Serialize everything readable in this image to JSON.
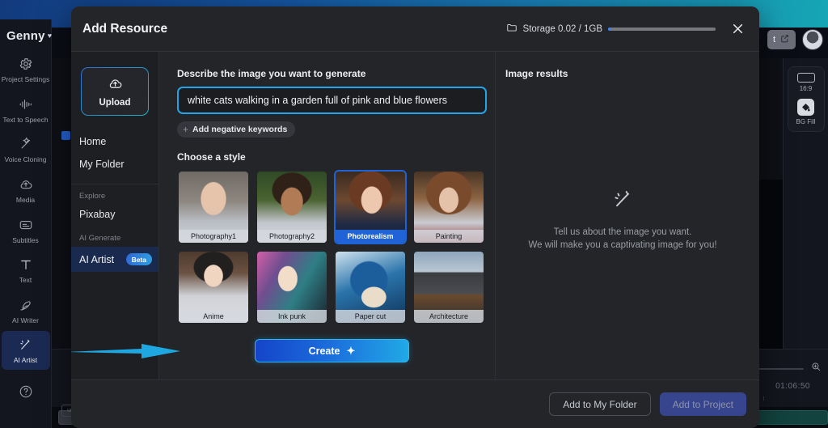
{
  "background_app": {
    "logo": "Genny",
    "nav_items": [
      {
        "label": "Project Settings",
        "icon": "gear-icon",
        "active": false
      },
      {
        "label": "Text to Speech",
        "icon": "waveform-icon",
        "active": false
      },
      {
        "label": "Voice Cloning",
        "icon": "voice-clone-icon",
        "active": false
      },
      {
        "label": "Media",
        "icon": "cloud-upload-icon",
        "active": false
      },
      {
        "label": "Subtitles",
        "icon": "subtitles-icon",
        "active": false
      },
      {
        "label": "Text",
        "icon": "text-icon",
        "active": false
      },
      {
        "label": "AI Writer",
        "icon": "pen-icon",
        "active": false
      },
      {
        "label": "AI Artist",
        "icon": "magic-wand-icon",
        "active": true
      }
    ],
    "help_icon": "question-circle-icon",
    "right_rail": {
      "aspect_ratio": "16:9",
      "bg_fill": "BG Fill"
    },
    "timeline": {
      "timestamp": "01:06:50",
      "zoom_icon": "zoom-in-icon"
    },
    "topbar": {
      "export_label": "t",
      "share_icon": "share-icon",
      "avatar": "user-avatar"
    }
  },
  "modal": {
    "title": "Add Resource",
    "storage": {
      "icon": "folder-icon",
      "label": "Storage 0.02 / 1GB",
      "percent": 2
    },
    "close_icon": "close-icon",
    "sidebar": {
      "upload": {
        "label": "Upload",
        "icon": "cloud-upload-icon"
      },
      "links": [
        {
          "label": "Home"
        },
        {
          "label": "My Folder"
        }
      ],
      "groups": [
        {
          "title": "Explore",
          "items": [
            {
              "label": "Pixabay",
              "active": false
            }
          ]
        },
        {
          "title": "AI Generate",
          "items": [
            {
              "label": "AI Artist",
              "active": true,
              "badge": "Beta"
            }
          ]
        }
      ]
    },
    "generator": {
      "describe_label": "Describe the image you want to generate",
      "prompt_value": "white cats walking in a garden full of pink and blue flowers",
      "prompt_placeholder": "Describe the image you want to generate",
      "negative_keywords_label": "Add negative keywords",
      "negative_keywords_plus": "+",
      "style_label": "Choose a style",
      "styles": [
        {
          "label": "Photography1",
          "selected": false,
          "art": "img-p1"
        },
        {
          "label": "Photography2",
          "selected": false,
          "art": "img-p2"
        },
        {
          "label": "Photorealism",
          "selected": true,
          "art": "img-pr"
        },
        {
          "label": "Painting",
          "selected": false,
          "art": "img-pa"
        },
        {
          "label": "Anime",
          "selected": false,
          "art": "img-an"
        },
        {
          "label": "Ink punk",
          "selected": false,
          "art": "img-ip"
        },
        {
          "label": "Paper cut",
          "selected": false,
          "art": "img-pc"
        },
        {
          "label": "Architecture",
          "selected": false,
          "art": "img-ar"
        }
      ],
      "create_label": "Create",
      "create_icon": "sparkle-icon"
    },
    "results": {
      "title": "Image results",
      "empty_icon": "magic-wand-icon",
      "empty_line1": "Tell us about the image you want.",
      "empty_line2": "We will make you a captivating image for you!"
    },
    "footer": {
      "add_to_folder": "Add to My Folder",
      "add_to_project": "Add to Project"
    }
  },
  "colors": {
    "accent_blue": "#23a4e8",
    "selected_blue": "#1f63d6",
    "modal_bg": "#232529",
    "sidebar_bg": "#1d1f23",
    "arrow": "#1ea7e0"
  }
}
